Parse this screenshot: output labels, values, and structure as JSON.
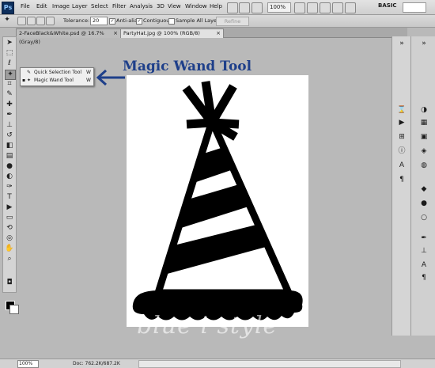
{
  "menubar": {
    "logo": "Ps",
    "items": [
      "File",
      "Edit",
      "Image",
      "Layer",
      "Select",
      "Filter",
      "Analysis",
      "3D",
      "View",
      "Window",
      "Help"
    ],
    "zoom": "100%",
    "workspace": "BASIC"
  },
  "options": {
    "tolerance_label": "Tolerance:",
    "tolerance_value": "20",
    "anti_alias_label": "Anti-alias",
    "contiguous_label": "Contiguous",
    "sample_all_label": "Sample All Layers",
    "refine_label": "Refine Edge..."
  },
  "tabs": [
    {
      "label": "2-FaceBlack&White.psd @ 16.7% (Gray/8)",
      "active": false
    },
    {
      "label": "PartyHat.jpg @ 100% (RGB/8)",
      "active": true
    }
  ],
  "flyout": {
    "items": [
      {
        "label": "Quick Selection Tool",
        "shortcut": "W"
      },
      {
        "label": "Magic Wand Tool",
        "shortcut": "W"
      }
    ]
  },
  "annotation": "Magic Wand Tool",
  "annotation_color": "#1e3f8a",
  "watermark": "blue i style",
  "status": {
    "zoom": "100%",
    "doc": "Doc: 762.2K/687.2K"
  }
}
